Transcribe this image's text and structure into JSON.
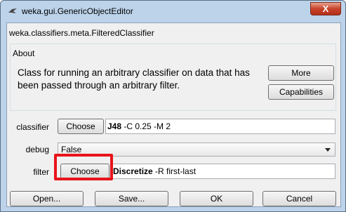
{
  "window": {
    "title": "weka.gui.GenericObjectEditor",
    "close_label": "X"
  },
  "editor": {
    "class_name": "weka.classifiers.meta.FilteredClassifier",
    "about": {
      "heading": "About",
      "description": "Class for running an arbitrary classifier on data that has been passed through an arbitrary filter.",
      "more_label": "More",
      "capabilities_label": "Capabilities"
    },
    "classifier": {
      "label": "classifier",
      "choose_label": "Choose",
      "value_name": "J48",
      "value_options": " -C 0.25 -M 2"
    },
    "debug": {
      "label": "debug",
      "value": "False"
    },
    "filter": {
      "label": "filter",
      "choose_label": "Choose",
      "value_name": "Discretize",
      "value_options": " -R first-last"
    },
    "buttons": {
      "open_label": "Open...",
      "save_label": "Save...",
      "ok_label": "OK",
      "cancel_label": "Cancel"
    }
  },
  "colors": {
    "highlight": "#e8141b",
    "titlebar": "#bcd3ea"
  }
}
